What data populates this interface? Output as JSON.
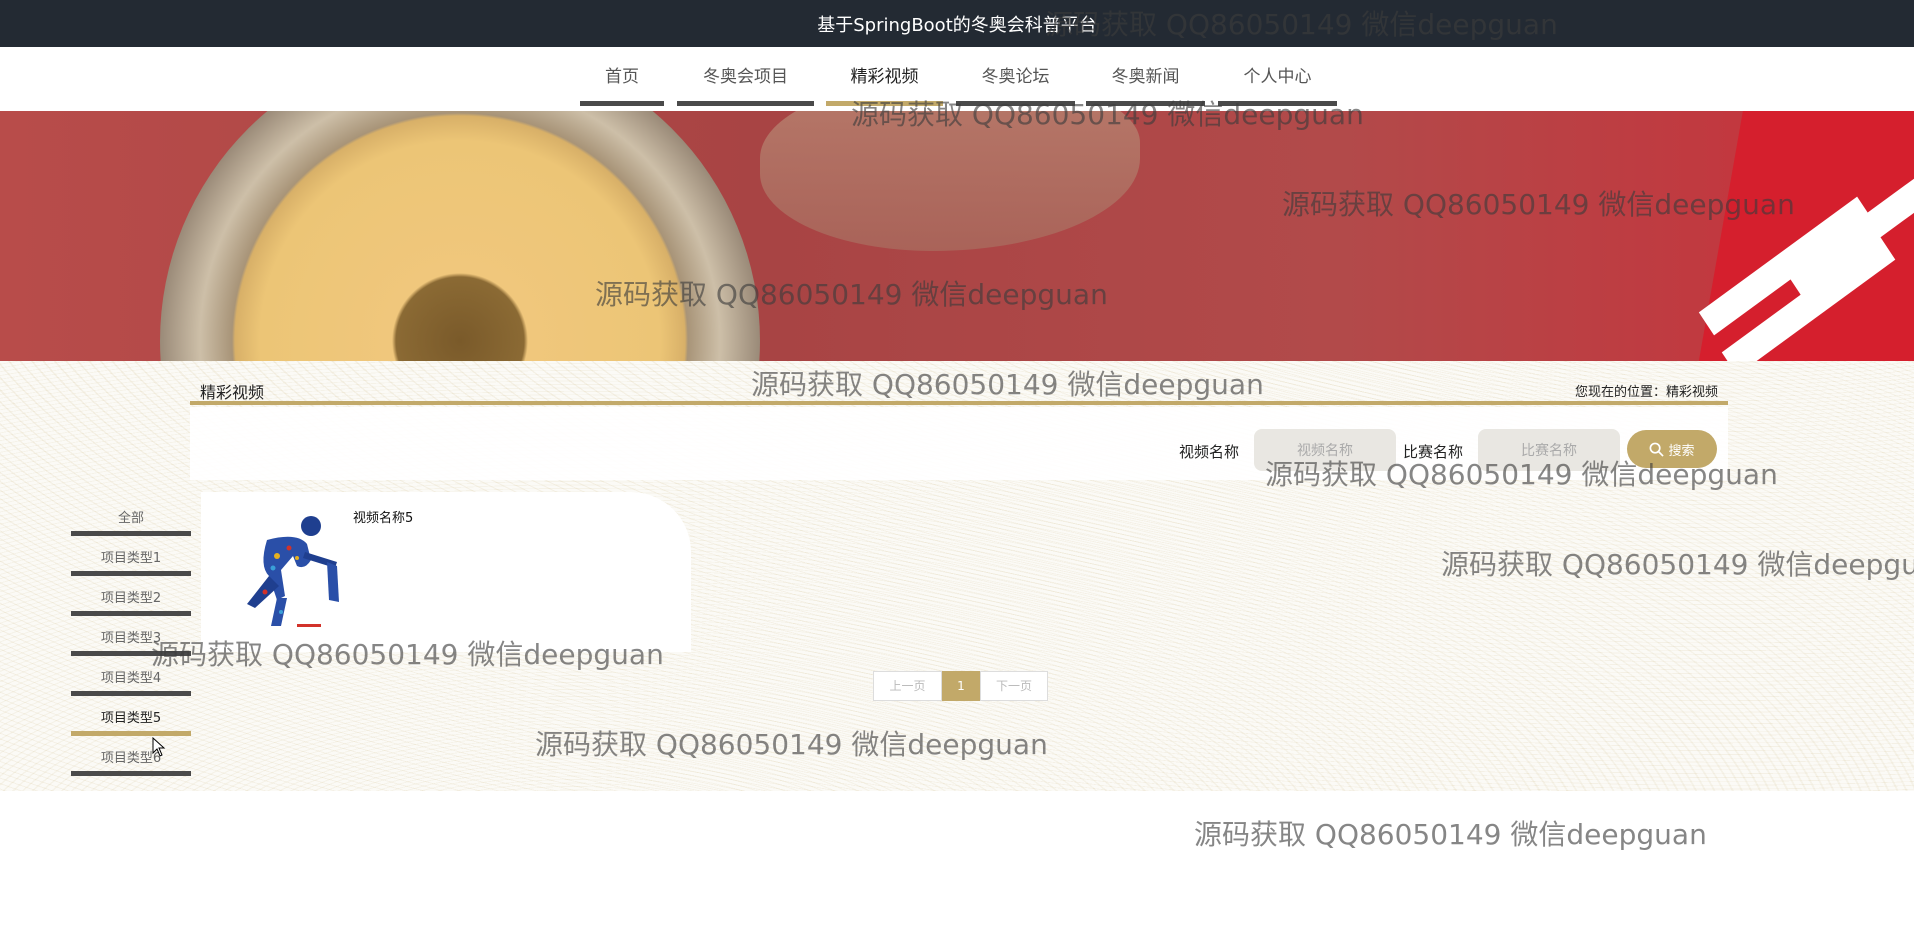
{
  "app": {
    "title": "基于SpringBoot的冬奥会科普平台"
  },
  "nav": {
    "items": [
      {
        "label": "首页"
      },
      {
        "label": "冬奥会项目"
      },
      {
        "label": "精彩视频"
      },
      {
        "label": "冬奥论坛"
      },
      {
        "label": "冬奥新闻"
      },
      {
        "label": "个人中心"
      }
    ],
    "active": "精彩视频"
  },
  "page": {
    "title": "精彩视频",
    "location_prefix": "您现在的位置：",
    "location": "精彩视频"
  },
  "search": {
    "video_label": "视频名称",
    "video_placeholder": "视频名称",
    "match_label": "比赛名称",
    "match_placeholder": "比赛名称",
    "button": "搜索"
  },
  "categories": {
    "items": [
      {
        "label": "全部"
      },
      {
        "label": "项目类型1"
      },
      {
        "label": "项目类型2"
      },
      {
        "label": "项目类型3"
      },
      {
        "label": "项目类型4"
      },
      {
        "label": "项目类型5"
      },
      {
        "label": "项目类型6"
      }
    ],
    "active": "项目类型5"
  },
  "videos": [
    {
      "name": "视频名称5",
      "icon": "ice-hockey-player-icon"
    }
  ],
  "pagination": {
    "prev": "上一页",
    "current": "1",
    "next": "下一页"
  },
  "watermark": "源码获取 QQ86050149 微信deepguan",
  "colors": {
    "accent": "#c2a969",
    "topbar": "#232a33",
    "nav_underline": "#4a4a4a"
  }
}
